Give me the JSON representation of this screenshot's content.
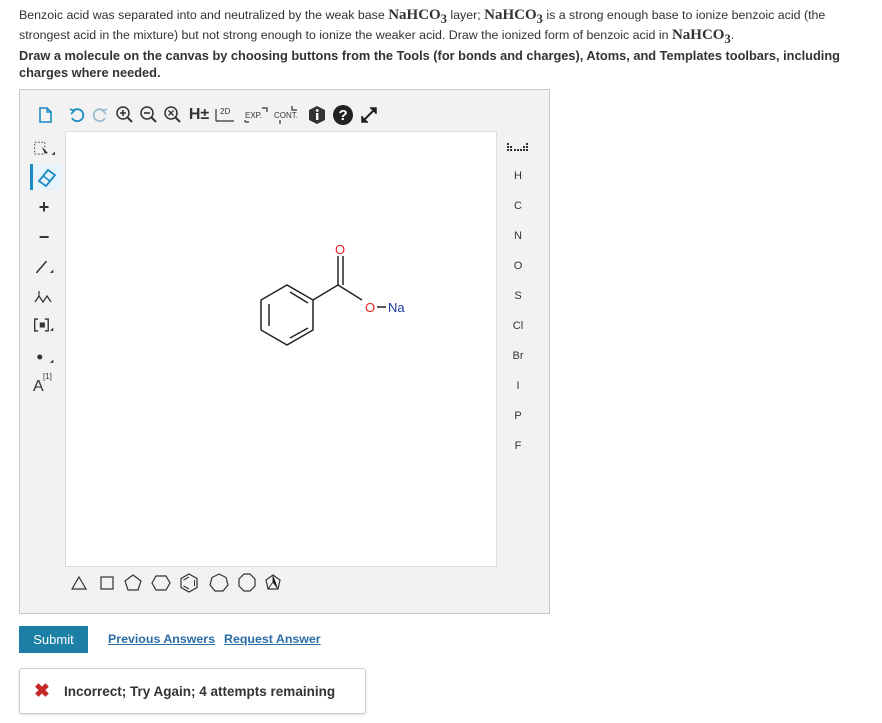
{
  "question": {
    "line1_pre": "Benzoic acid was separated into and neutralized by the weak base ",
    "chem1": "NaHCO",
    "chem1_sub": "3",
    "line1_mid": " layer; ",
    "chem2": "NaHCO",
    "chem2_sub": "3",
    "line1_post": " is a strong enough base to ionize benzoic acid (the strongest acid in the mixture) but not strong enough to ionize the weaker acid.  Draw the ionized form of benzoic acid in ",
    "chem3": "NaHCO",
    "chem3_sub": "3",
    "line1_end": ".",
    "instruction": "Draw a molecule on the canvas by choosing buttons from the Tools (for bonds and charges), Atoms, and Templates toolbars, including charges where needed."
  },
  "top_toolbar": {
    "h_label": "H±",
    "twod_label": "2D",
    "exp_label": "EXP.",
    "cont_label": "CONT."
  },
  "left_toolbar": {
    "charge_plus": "+",
    "charge_minus": "−",
    "atom_map_label": "A",
    "atom_map_index": "[1]"
  },
  "atoms": [
    "H",
    "C",
    "N",
    "O",
    "S",
    "Cl",
    "Br",
    "I",
    "P",
    "F"
  ],
  "molecule": {
    "oxygen_top": "O",
    "oxygen_ester": "O",
    "sodium": "Na"
  },
  "actions": {
    "submit": "Submit",
    "previous_answers": "Previous Answers",
    "request_answer": "Request Answer"
  },
  "feedback": {
    "text": "Incorrect; Try Again; 4 attempts remaining",
    "color": "#c62828"
  },
  "colors": {
    "accent": "#1c7fa6",
    "link": "#2a6ca8"
  }
}
